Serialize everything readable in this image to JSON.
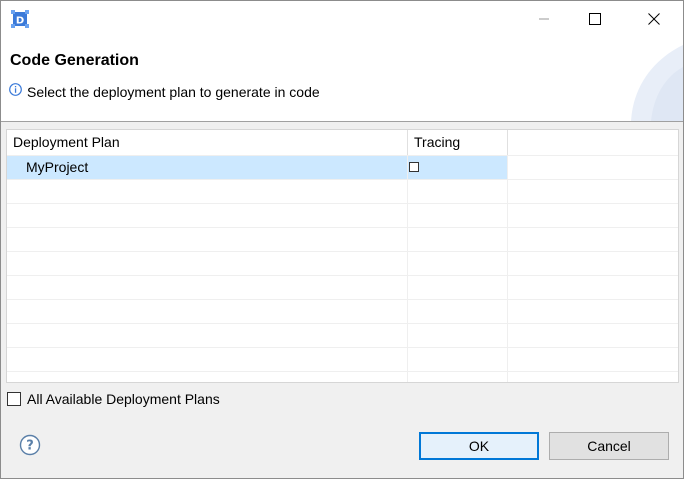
{
  "dialog": {
    "title": "Code Generation",
    "message": "Select the deployment plan to generate in code"
  },
  "table": {
    "columns": [
      "Deployment Plan",
      "Tracing"
    ],
    "rows": [
      {
        "name": "MyProject",
        "tracing": false,
        "selected": true
      }
    ]
  },
  "options": {
    "all_plans_label": "All Available Deployment Plans",
    "all_plans_checked": false
  },
  "buttons": {
    "ok": "OK",
    "cancel": "Cancel"
  },
  "icons": {
    "app": "app-logo-icon",
    "info": "info-icon",
    "help": "help-icon"
  },
  "colors": {
    "selection": "#cce8ff",
    "accent": "#0078d7"
  }
}
